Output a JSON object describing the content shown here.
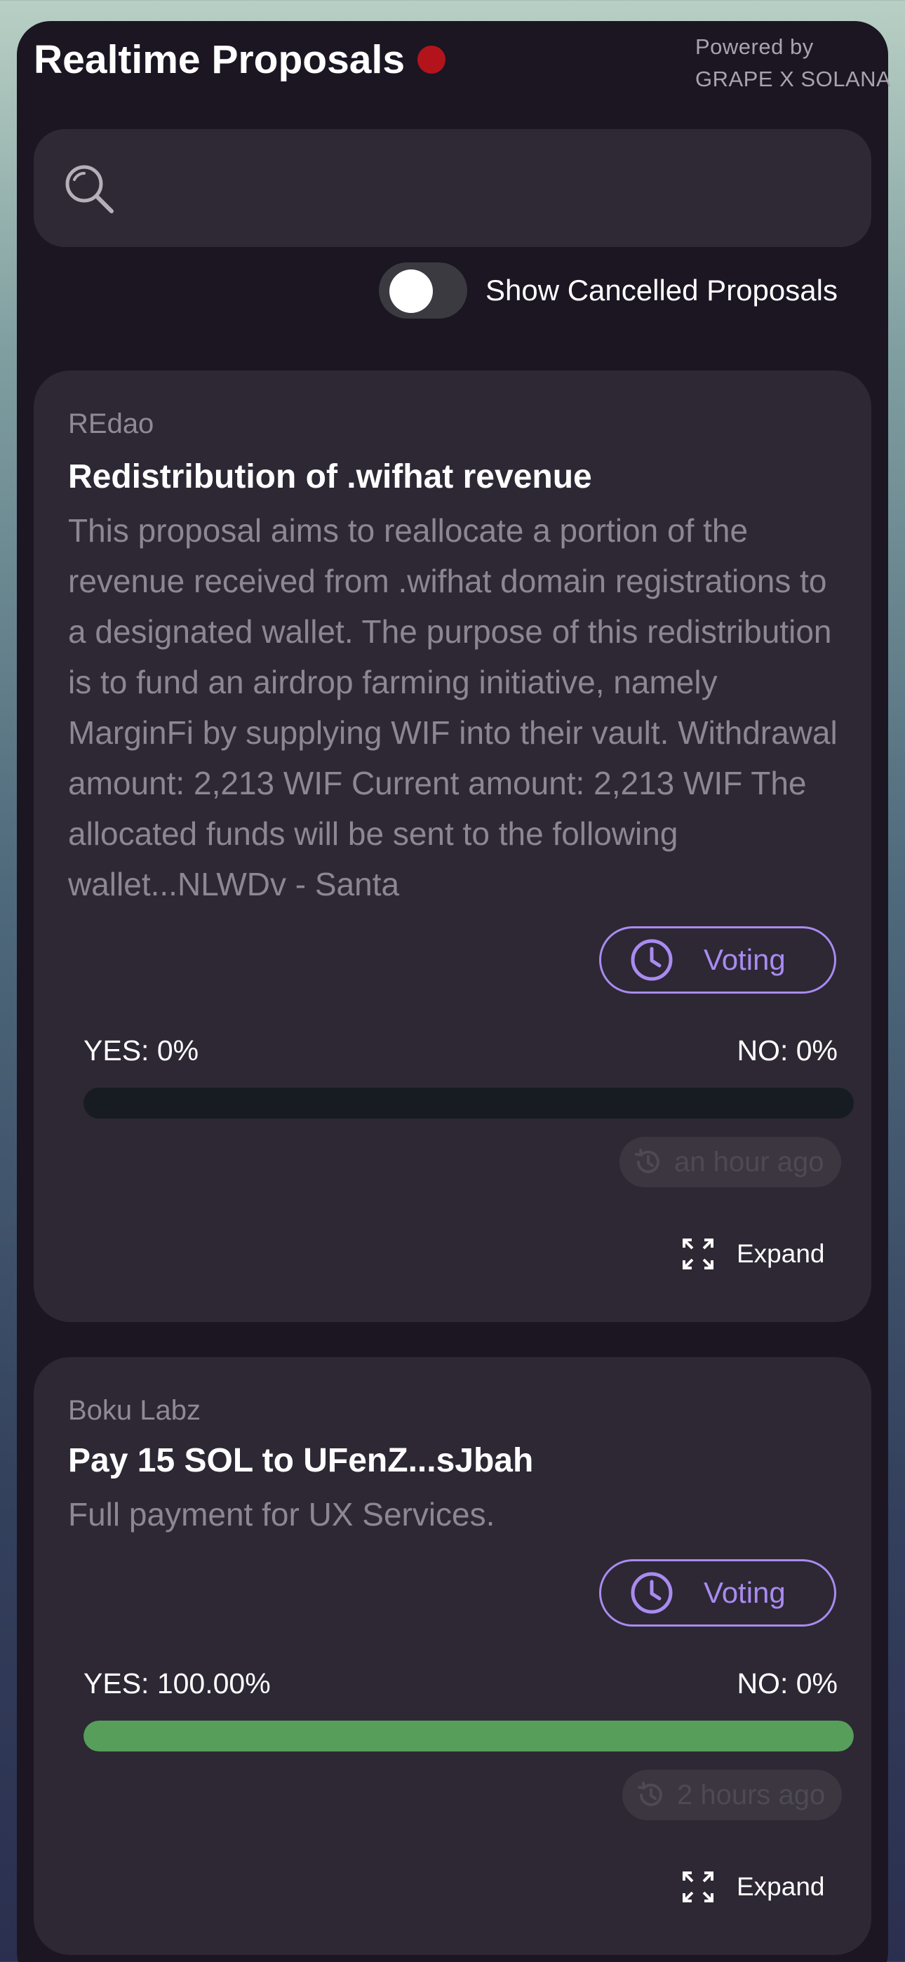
{
  "header": {
    "title": "Realtime Proposals",
    "powered_line1": "Powered by",
    "powered_line2": "GRAPE X SOLANA"
  },
  "search": {
    "value": "",
    "placeholder": ""
  },
  "toggle": {
    "label": "Show Cancelled Proposals",
    "on": false
  },
  "colors": {
    "accent": "#a98bf0",
    "live_dot": "#b3141c",
    "yes_bar": "#579e5b",
    "card_bg": "#2d2834"
  },
  "proposals": [
    {
      "dao": "REdao",
      "title": "Redistribution of .wifhat revenue",
      "description": "This proposal aims to reallocate a portion of the revenue received from .wifhat domain registrations to a designated wallet. The purpose of this redistribution is to fund an airdrop farming initiative, namely MarginFi by supplying WIF into their vault. Withdrawal amount: 2,213 WIF Current amount: 2,213 WIF The allocated funds will be sent to the following wallet...NLWDv - Santa",
      "status": "Voting",
      "yes": "YES: 0%",
      "no": "NO: 0%",
      "yes_fraction": 0,
      "time": "an hour ago",
      "expand": "Expand"
    },
    {
      "dao": "Boku Labz",
      "title": "Pay 15 SOL to UFenZ...sJbah",
      "description": "Full payment for UX Services.",
      "status": "Voting",
      "yes": "YES: 100.00%",
      "no": "NO: 0%",
      "yes_fraction": 1,
      "time": "2 hours ago",
      "expand": "Expand"
    }
  ]
}
